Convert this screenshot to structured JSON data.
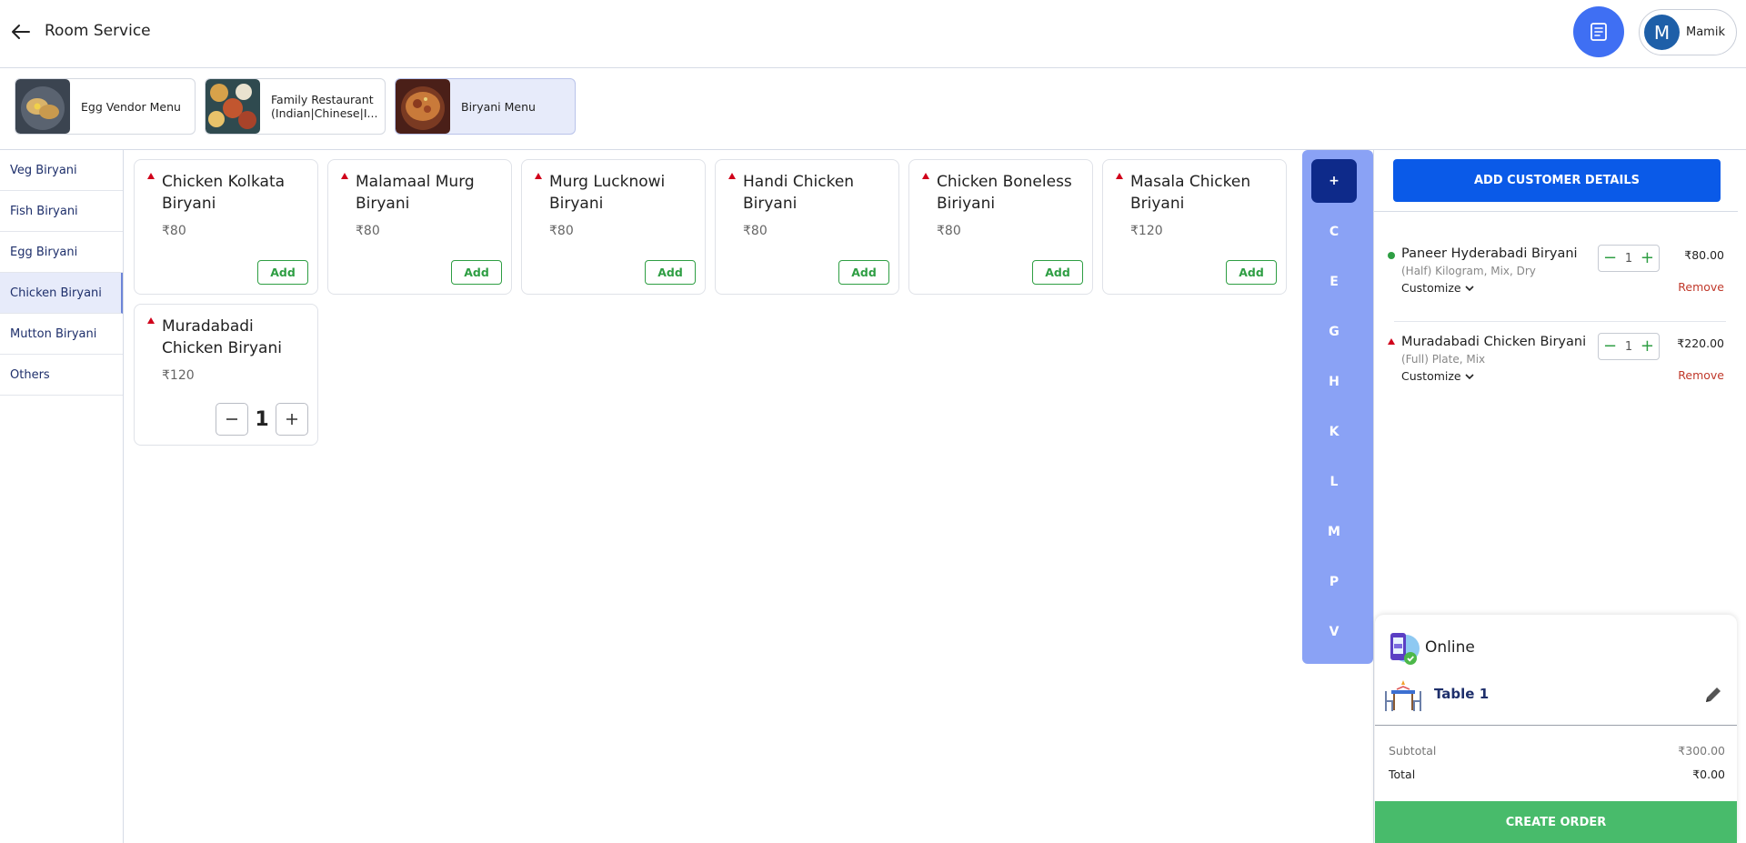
{
  "header": {
    "title": "Room Service",
    "user": {
      "initial": "M",
      "name": "Mamik"
    }
  },
  "menus": [
    {
      "name": "Egg Vendor Menu",
      "active": false
    },
    {
      "name": "Family Restaurant (Indian|Chinese|I...",
      "active": false
    },
    {
      "name": "Biryani Menu",
      "active": true
    }
  ],
  "categories": [
    {
      "label": "Veg Biryani",
      "active": false
    },
    {
      "label": "Fish Biryani",
      "active": false
    },
    {
      "label": "Egg Biryani",
      "active": false
    },
    {
      "label": "Chicken Biryani",
      "active": true
    },
    {
      "label": "Mutton Biryani",
      "active": false
    },
    {
      "label": "Others",
      "active": false
    }
  ],
  "items": [
    {
      "name": "Chicken Kolkata Biryani",
      "price": "₹80",
      "action": "Add"
    },
    {
      "name": "Malamaal Murg Biryani",
      "price": "₹80",
      "action": "Add"
    },
    {
      "name": "Murg Lucknowi Biryani",
      "price": "₹80",
      "action": "Add"
    },
    {
      "name": "Handi Chicken Biryani",
      "price": "₹80",
      "action": "Add"
    },
    {
      "name": "Chicken Boneless Biriyani",
      "price": "₹80",
      "action": "Add"
    },
    {
      "name": "Masala Chicken Briyani",
      "price": "₹120",
      "action": "Add"
    },
    {
      "name": "Muradabadi Chicken Biryani",
      "price": "₹120",
      "qty": "1"
    }
  ],
  "alphabet": [
    "+",
    "C",
    "E",
    "G",
    "H",
    "K",
    "L",
    "M",
    "P",
    "V"
  ],
  "alphabet_active": "+",
  "cart": {
    "add_customer_label": "ADD CUSTOMER DETAILS",
    "items": [
      {
        "name": "Paneer Hyderabadi Biryani",
        "variant": "(Half) Kilogram, Mix, Dry",
        "customize": "Customize",
        "qty": "1",
        "price": "₹80.00",
        "remove": "Remove",
        "veg": true
      },
      {
        "name": "Muradabadi Chicken Biryani",
        "variant": "(Full) Plate, Mix",
        "customize": "Customize",
        "qty": "1",
        "price": "₹220.00",
        "remove": "Remove",
        "veg": false
      }
    ],
    "payment_mode": "Online",
    "table": "Table 1",
    "subtotal_label": "Subtotal",
    "subtotal_value": "₹300.00",
    "total_label": "Total",
    "total_value": "₹0.00",
    "create_label": "CREATE ORDER"
  }
}
